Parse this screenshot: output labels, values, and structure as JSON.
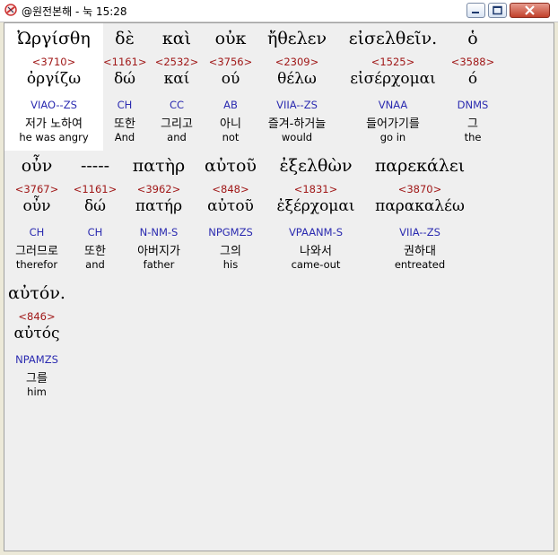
{
  "window": {
    "title": "@원전본해 - 눅 15:28",
    "icon": "bible-app-icon"
  },
  "rows": [
    {
      "tokens": [
        {
          "greek": "Ὠργίσθη",
          "strong": "<3710>",
          "lemma": "ὀργίζω",
          "morph": "VIAO--ZS",
          "korean": "저가 노하여",
          "english": "he was angry",
          "highlight": true
        },
        {
          "greek": "δὲ",
          "strong": "<1161>",
          "lemma": "δώ",
          "morph": "CH",
          "korean": "또한",
          "english": "And"
        },
        {
          "greek": "καὶ",
          "strong": "<2532>",
          "lemma": "καί",
          "morph": "CC",
          "korean": "그리고",
          "english": "and"
        },
        {
          "greek": "οὐκ",
          "strong": "<3756>",
          "lemma": "ού",
          "morph": "AB",
          "korean": "아니",
          "english": "not"
        },
        {
          "greek": "ἤθελεν",
          "strong": "<2309>",
          "lemma": "θέλω",
          "morph": "VIIA--ZS",
          "korean": "즐겨-하거늘",
          "english": "would"
        },
        {
          "greek": "εἰσελθεῖν.",
          "strong": "<1525>",
          "lemma": "εἰσέρχομαι",
          "morph": "VNAA",
          "korean": "들어가기를",
          "english": "go in"
        },
        {
          "greek": "ὁ",
          "strong": "<3588>",
          "lemma": "ό",
          "morph": "DNMS",
          "korean": "그",
          "english": "the"
        }
      ]
    },
    {
      "tokens": [
        {
          "greek": "οὖν",
          "strong": "<3767>",
          "lemma": "οὖν",
          "morph": "CH",
          "korean": "그러므로",
          "english": "therefor"
        },
        {
          "greek": "-----",
          "strong": "<1161>",
          "lemma": "δώ",
          "morph": "CH",
          "korean": "또한",
          "english": "and"
        },
        {
          "greek": "πατὴρ",
          "strong": "<3962>",
          "lemma": "πατήρ",
          "morph": "N-NM-S",
          "korean": "아버지가",
          "english": "father"
        },
        {
          "greek": "αὐτοῦ",
          "strong": "<848>",
          "lemma": "αὐτοῦ",
          "morph": "NPGMZS",
          "korean": "그의",
          "english": "his"
        },
        {
          "greek": "ἐξελθὼν",
          "strong": "<1831>",
          "lemma": "ἐξέρχομαι",
          "morph": "VPAANM-S",
          "korean": "나와서",
          "english": "came-out"
        },
        {
          "greek": "παρεκάλει",
          "strong": "<3870>",
          "lemma": "παρακαλέω",
          "morph": "VIIA--ZS",
          "korean": "권하대",
          "english": "entreated"
        }
      ]
    },
    {
      "tokens": [
        {
          "greek": "αὐτόν.",
          "strong": "<846>",
          "lemma": "αὐτός",
          "morph": "NPAMZS",
          "korean": "그를",
          "english": "him"
        }
      ]
    }
  ]
}
